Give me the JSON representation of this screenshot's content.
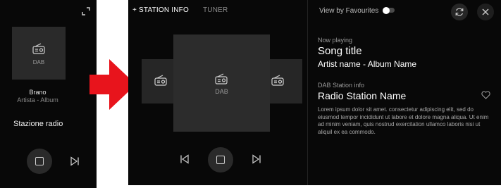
{
  "left_player": {
    "art_label": "DAB",
    "song": "Brano",
    "artist_album": "Artista - Album",
    "station": "Stazione radio"
  },
  "tabs": [
    {
      "label": "+ STATION INFO",
      "active": true
    },
    {
      "label": "TUNER",
      "active": false
    }
  ],
  "carousel": {
    "main_label": "DAB"
  },
  "favourites": {
    "label": "View by Favourites",
    "enabled": false
  },
  "now_playing": {
    "label": "Now playing",
    "title": "Song title",
    "artist_album": "Artist name - Album Name"
  },
  "station_info": {
    "label": "DAB Station info",
    "name": "Radio Station Name",
    "description": "Lorem ipsum dolor sit amet. consectetur adipiscing elit, sed do eiusmod tempor incididunt ut labore et dolore magna aliqua. Ut enim ad minim veniam, quis nostrud exercitation ullamco laboris nisi ut aliquil ex ea commodo."
  },
  "icons": {
    "expand": "expand-icon",
    "radio": "radio-icon",
    "stop": "stop-icon",
    "next": "skip-next-icon",
    "previous": "skip-previous-icon",
    "refresh": "refresh-icon",
    "close": "close-icon",
    "favourite": "heart-icon"
  },
  "colors": {
    "background": "#080808",
    "arrow": "#e8141c",
    "card": "#2c2c2c"
  }
}
